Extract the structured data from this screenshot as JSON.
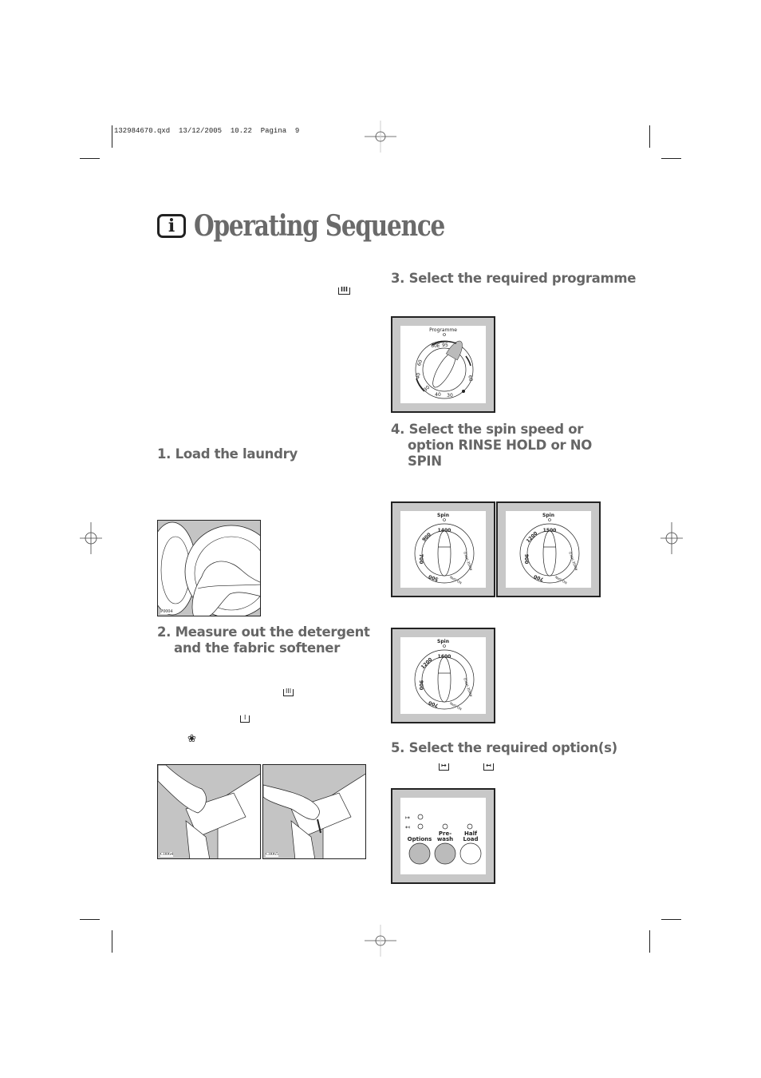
{
  "slug": {
    "filename": "132984670.qxd",
    "date": "13/12/2005",
    "time": "10.22",
    "page_label": "Pagina",
    "page_number": "9"
  },
  "header": {
    "icon": "info-icon",
    "icon_glyph": "i",
    "title": "Operating Sequence"
  },
  "sections": [
    {
      "number": "1.",
      "lines": [
        "Load the laundry"
      ],
      "image_code": "P0004"
    },
    {
      "number": "2.",
      "lines": [
        "Measure out the detergent",
        "and the fabric softener"
      ],
      "image_codes": [
        "C0064",
        "C0065"
      ],
      "symbols": [
        "main-wash-compartment-icon",
        "prewash-compartment-icon",
        "fabric-softener-icon"
      ]
    },
    {
      "number": "3.",
      "lines": [
        "Select the required programme"
      ],
      "dial_label": "Programme",
      "dial_marks": [
        "95",
        "60E",
        "60",
        "40",
        "30",
        "40",
        "30",
        "60"
      ]
    },
    {
      "number": "4.",
      "lines": [
        "Select the spin speed or",
        "option RINSE HOLD or NO",
        "SPIN"
      ]
    },
    {
      "number": "5.",
      "lines": [
        "Select the required option(s)"
      ],
      "symbols": [
        "extra-rinse-icon",
        "short-wash-icon"
      ]
    }
  ],
  "symbols": {
    "main_wash": "III",
    "prewash": "I",
    "softener": "❀",
    "extra_rinse": "↦",
    "short": "↤"
  },
  "spin_dials": [
    {
      "label": "Spin",
      "top": "1400",
      "marks": [
        "900",
        "700",
        "500"
      ],
      "no_spin": "NO SPIN",
      "rinse_hold": "RINSE HOLD"
    },
    {
      "label": "Spin",
      "top": "1500",
      "marks": [
        "1200",
        "900",
        "700"
      ],
      "no_spin": "NO SPIN",
      "rinse_hold": "RINSE HOLD"
    },
    {
      "label": "Spin",
      "top": "1600",
      "marks": [
        "1200",
        "900",
        "700"
      ],
      "no_spin": "NO SPIN",
      "rinse_hold": "RINSE HOLD"
    }
  ],
  "options_panel": {
    "buttons": [
      {
        "label_lines": [
          "Options"
        ],
        "state": "grey"
      },
      {
        "label_lines": [
          "Pre-",
          "wash"
        ],
        "state": "grey"
      },
      {
        "label_lines": [
          "Half",
          "Load"
        ],
        "state": "white"
      }
    ]
  }
}
